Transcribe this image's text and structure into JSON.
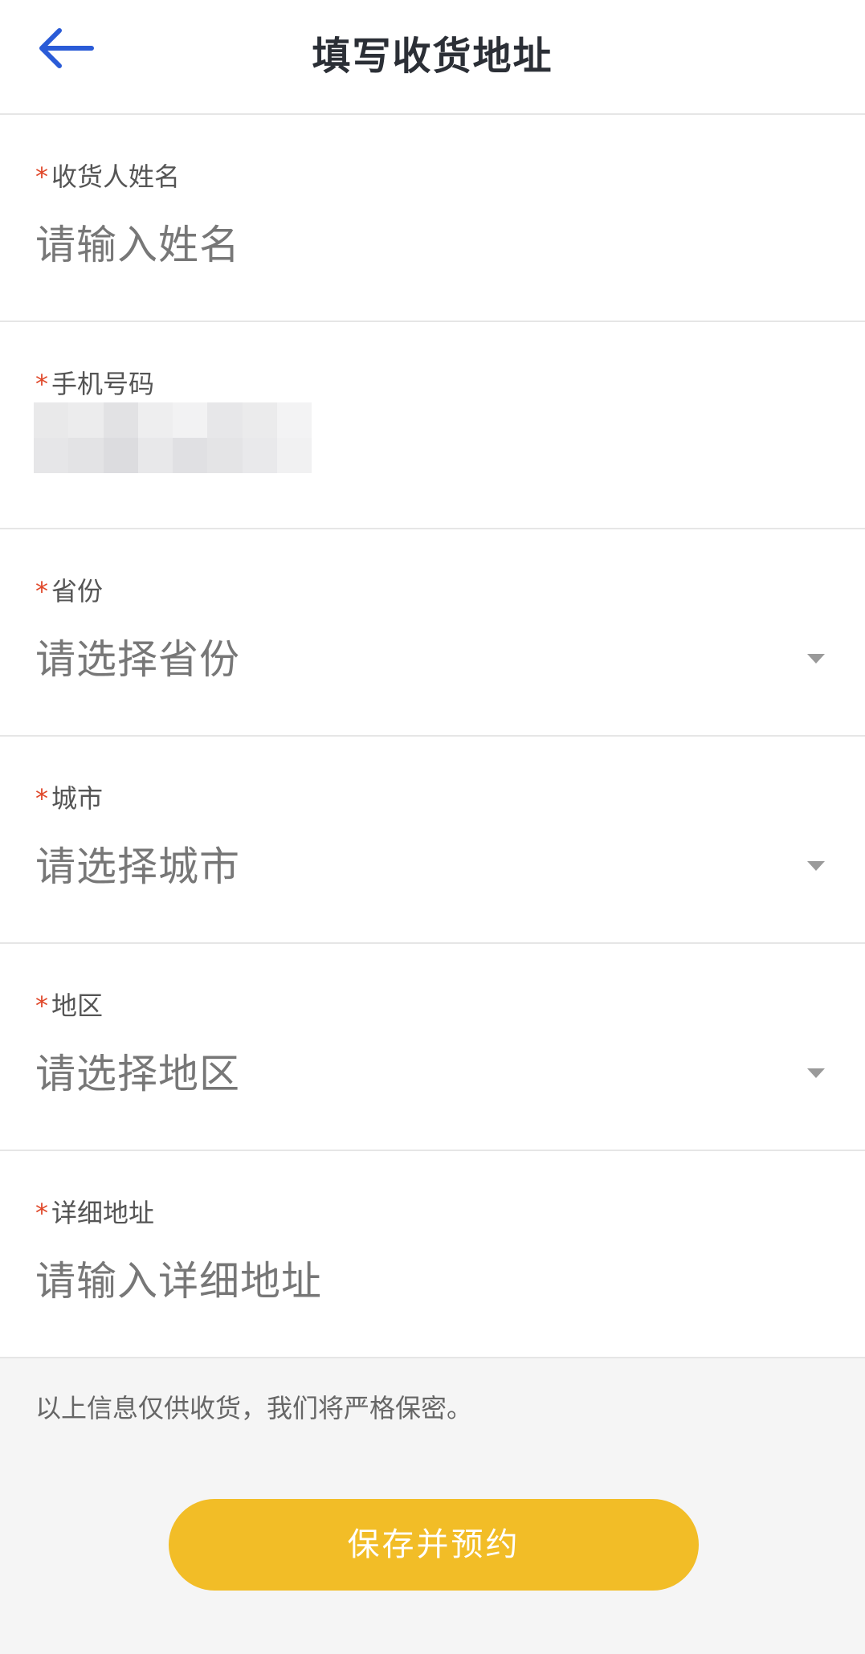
{
  "header": {
    "title": "填写收货地址",
    "back_icon": "arrow-left-icon",
    "accent_color": "#2a5bd7"
  },
  "form": {
    "required_mark": "*",
    "fields": [
      {
        "label": "收货人姓名",
        "placeholder": "请输入姓名",
        "type": "input"
      },
      {
        "label": "手机号码",
        "value_masked": true,
        "type": "input"
      },
      {
        "label": "省份",
        "placeholder": "请选择省份",
        "type": "select"
      },
      {
        "label": "城市",
        "placeholder": "请选择城市",
        "type": "select"
      },
      {
        "label": "地区",
        "placeholder": "请选择地区",
        "type": "select"
      },
      {
        "label": "详细地址",
        "placeholder": "请输入详细地址",
        "type": "input"
      }
    ]
  },
  "note": "以上信息仅供收货，我们将严格保密。",
  "submit": {
    "label": "保存并预约",
    "color": "#f2bd27"
  }
}
